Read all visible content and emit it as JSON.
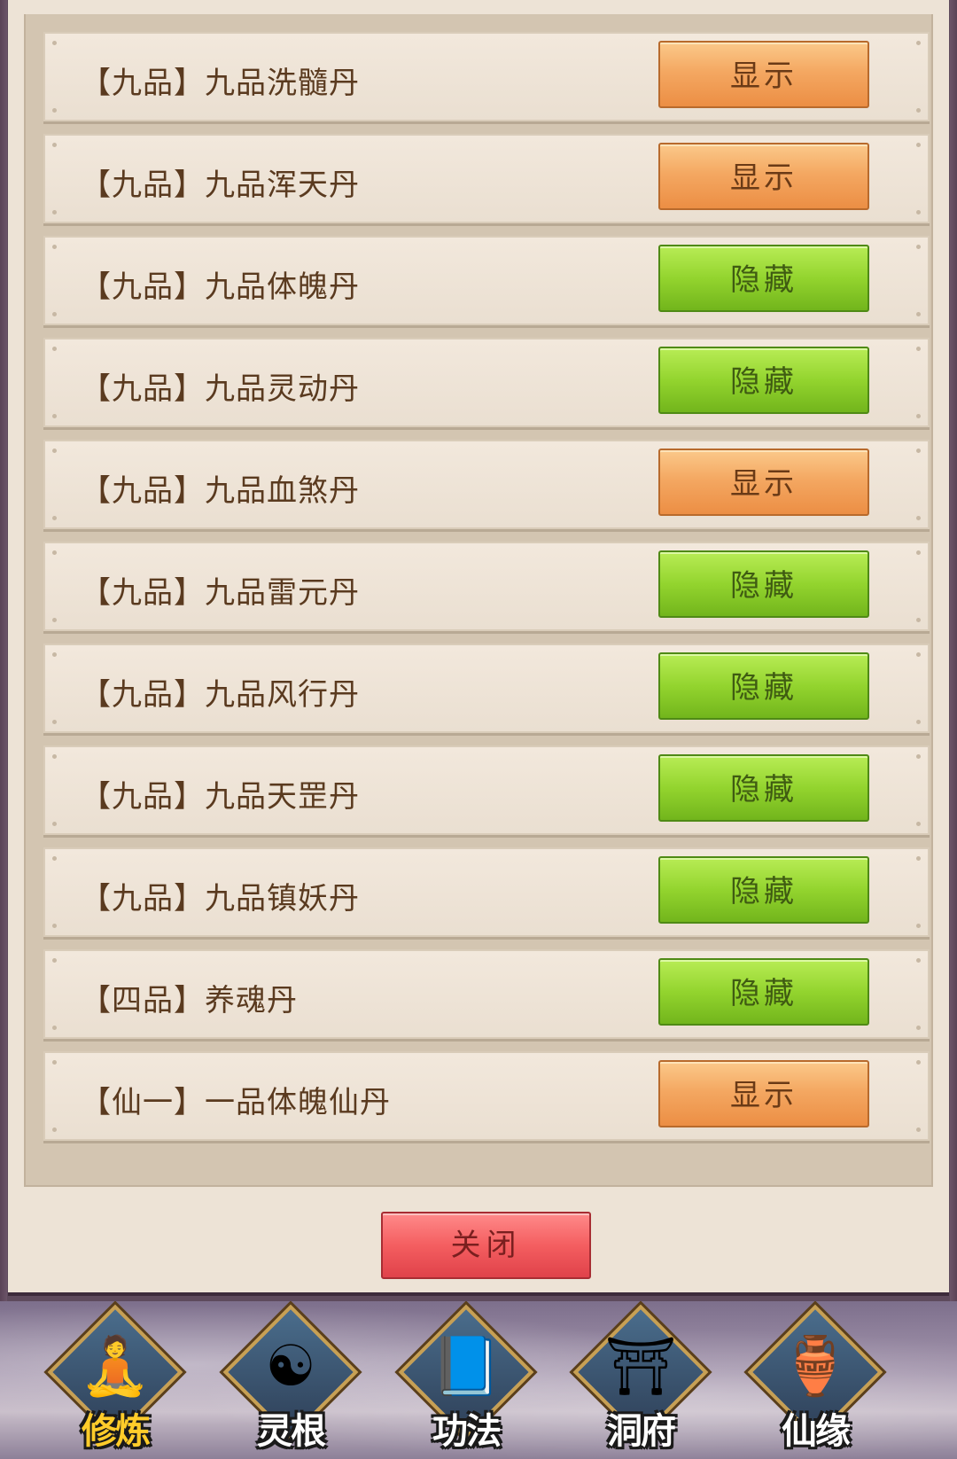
{
  "items": [
    {
      "label": "【九品】九品洗髓丹",
      "action": "显示",
      "state": "show"
    },
    {
      "label": "【九品】九品浑天丹",
      "action": "显示",
      "state": "show"
    },
    {
      "label": "【九品】九品体魄丹",
      "action": "隐藏",
      "state": "hide"
    },
    {
      "label": "【九品】九品灵动丹",
      "action": "隐藏",
      "state": "hide"
    },
    {
      "label": "【九品】九品血煞丹",
      "action": "显示",
      "state": "show"
    },
    {
      "label": "【九品】九品雷元丹",
      "action": "隐藏",
      "state": "hide"
    },
    {
      "label": "【九品】九品风行丹",
      "action": "隐藏",
      "state": "hide"
    },
    {
      "label": "【九品】九品天罡丹",
      "action": "隐藏",
      "state": "hide"
    },
    {
      "label": "【九品】九品镇妖丹",
      "action": "隐藏",
      "state": "hide"
    },
    {
      "label": "【四品】养魂丹",
      "action": "隐藏",
      "state": "hide"
    },
    {
      "label": "【仙一】一品体魄仙丹",
      "action": "显示",
      "state": "show"
    }
  ],
  "close_label": "关闭",
  "nav": [
    {
      "label": "修炼",
      "icon": "cultivation-icon",
      "glyph": "🧘",
      "active": true
    },
    {
      "label": "灵根",
      "icon": "spirit-root-icon",
      "glyph": "☯",
      "active": false
    },
    {
      "label": "功法",
      "icon": "technique-book-icon",
      "glyph": "📘",
      "active": false
    },
    {
      "label": "洞府",
      "icon": "cave-dwelling-icon",
      "glyph": "⛩",
      "active": false
    },
    {
      "label": "仙缘",
      "icon": "gourd-icon",
      "glyph": "🏺",
      "active": false
    }
  ],
  "colors": {
    "show_button": "#f4a862",
    "hide_button": "#93d42e",
    "close_button": "#f45e60",
    "active_nav_label": "#ffcc2a"
  }
}
